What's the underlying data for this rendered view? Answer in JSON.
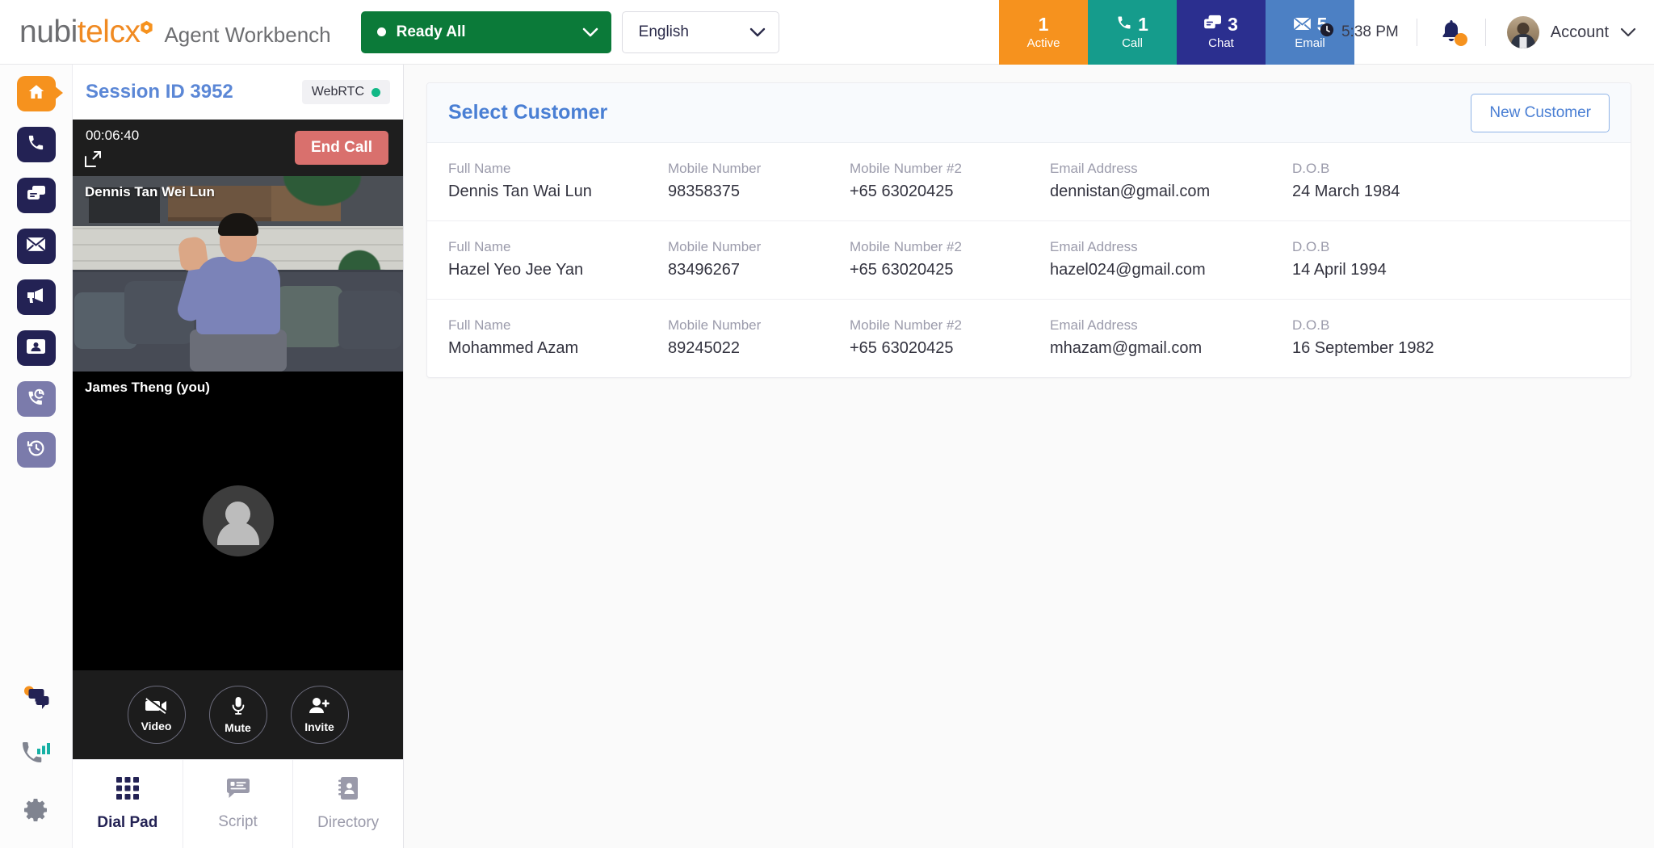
{
  "brand": {
    "logo_part1": "nubi",
    "logo_part2": "tel",
    "logo_part3": "cx",
    "app_title": "Agent Workbench",
    "accent_orange": "#f6921e",
    "accent_navy": "#232254",
    "accent_blue": "#4a7fd4"
  },
  "topbar": {
    "status": {
      "label": "Ready All",
      "color": "#0b7a39"
    },
    "language": {
      "label": "English"
    },
    "badges": [
      {
        "count": "1",
        "label": "Active",
        "icon": "none",
        "color": "#f6921e"
      },
      {
        "count": "1",
        "label": "Call",
        "icon": "phone-icon",
        "color": "#159c8c"
      },
      {
        "count": "3",
        "label": "Chat",
        "icon": "chat-icon",
        "color": "#2b2f8f"
      },
      {
        "count": "5",
        "label": "Email",
        "icon": "envelope-icon",
        "color": "#4c80c4"
      }
    ],
    "clock": "5:38 PM",
    "notification_icon": "bell-icon",
    "account_label": "Account"
  },
  "rail": {
    "items": [
      {
        "name": "home",
        "icon": "home-icon",
        "state": "selected"
      },
      {
        "name": "voice",
        "icon": "phone-icon",
        "state": "dark"
      },
      {
        "name": "chat",
        "icon": "chat-icon",
        "state": "dark"
      },
      {
        "name": "email",
        "icon": "envelope-icon",
        "state": "dark"
      },
      {
        "name": "campaign",
        "icon": "megaphone-icon",
        "state": "dark"
      },
      {
        "name": "contacts",
        "icon": "contact-card-icon",
        "state": "dark"
      },
      {
        "name": "callback",
        "icon": "phone-callback-icon",
        "state": "light"
      },
      {
        "name": "history",
        "icon": "history-clock-icon",
        "state": "light"
      }
    ],
    "bottom": [
      {
        "name": "conversations",
        "icon": "chat-bubbles-icon"
      },
      {
        "name": "call-stats",
        "icon": "phone-signal-icon"
      },
      {
        "name": "settings",
        "icon": "gear-icon"
      }
    ]
  },
  "session": {
    "title": "Session ID 3952",
    "connection": {
      "label": "WebRTC",
      "status_color": "#12b886"
    },
    "timer": "00:06:40",
    "end_call_label": "End Call",
    "expand_icon": "expand-icon",
    "remote_participant": "Dennis Tan Wei Lun",
    "local_participant": "James Theng (you)",
    "controls": [
      {
        "label": "Video",
        "icon": "video-off-icon"
      },
      {
        "label": "Mute",
        "icon": "microphone-icon"
      },
      {
        "label": "Invite",
        "icon": "person-add-icon"
      }
    ],
    "tabs": [
      {
        "label": "Dial Pad",
        "icon": "dialpad-icon",
        "selected": true
      },
      {
        "label": "Script",
        "icon": "script-icon",
        "selected": false
      },
      {
        "label": "Directory",
        "icon": "directory-book-icon",
        "selected": false
      }
    ]
  },
  "main": {
    "card_title": "Select Customer",
    "new_customer_label": "New Customer",
    "column_labels": {
      "full_name": "Full Name",
      "mobile": "Mobile Number",
      "mobile2": "Mobile Number #2",
      "email": "Email Address",
      "dob": "D.O.B"
    },
    "customers": [
      {
        "full_name": "Dennis Tan Wai Lun",
        "mobile": "98358375",
        "mobile2": "+65 63020425",
        "email": "dennistan@gmail.com",
        "dob": "24 March 1984"
      },
      {
        "full_name": "Hazel Yeo Jee Yan",
        "mobile": "83496267",
        "mobile2": "+65 63020425",
        "email": "hazel024@gmail.com",
        "dob": "14 April 1994"
      },
      {
        "full_name": "Mohammed Azam",
        "mobile": "89245022",
        "mobile2": "+65 63020425",
        "email": "mhazam@gmail.com",
        "dob": "16 September 1982"
      }
    ]
  }
}
